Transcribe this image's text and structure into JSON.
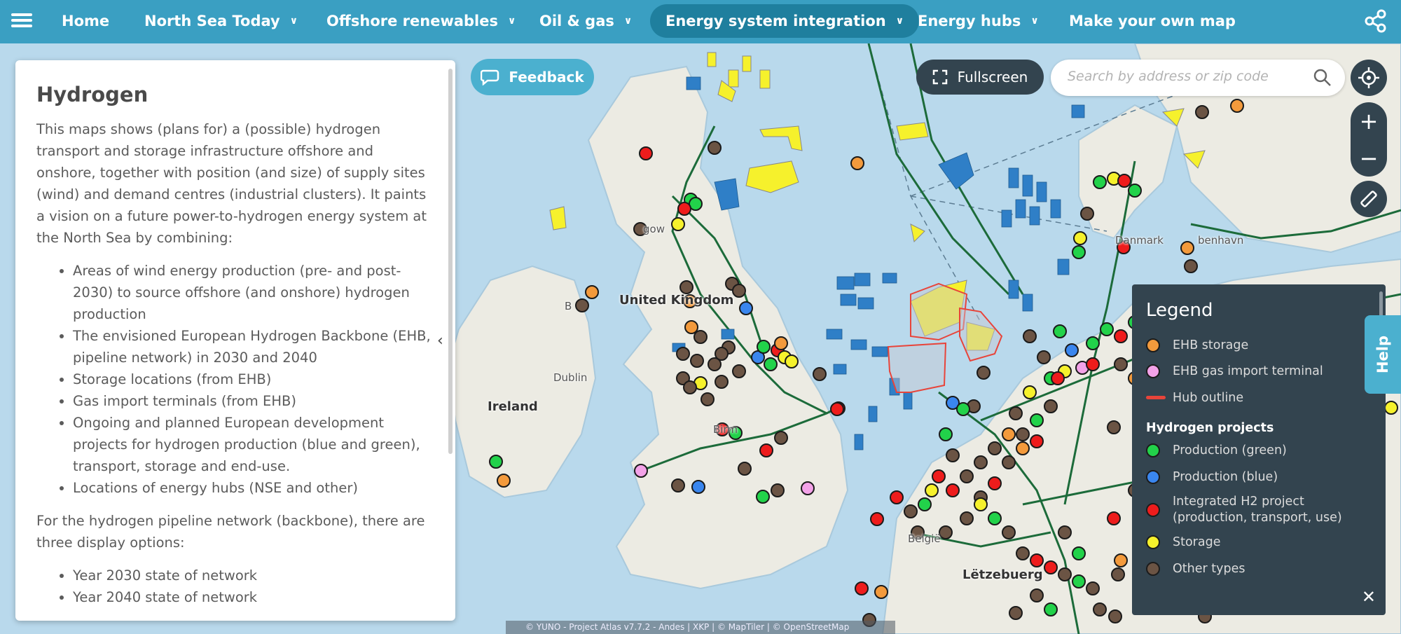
{
  "nav": {
    "home": "Home",
    "north_sea_today": "North Sea Today",
    "offshore_renewables": "Offshore renewables",
    "oil_gas": "Oil & gas",
    "energy_system_integration": "Energy system integration",
    "energy_hubs": "Energy hubs",
    "make_your_own_map": "Make your own map"
  },
  "panel": {
    "title": "Hydrogen",
    "intro": "This maps shows (plans for) a (possible) hydrogen transport and storage infrastructure offshore and onshore, together with position (and size) of supply sites (wind) and demand centres (industrial clusters). It paints a vision on a future power-to-hydrogen energy system at the North Sea by combining:",
    "bullets": [
      "Areas of wind energy production (pre- and post-2030) to source offshore (and onshore) hydrogen production",
      "The envisioned European Hydrogen Backbone (EHB, pipeline network) in 2030 and 2040",
      "Storage locations (from EHB)",
      "Gas import terminals (from EHB)",
      "Ongoing and planned European development projects for hydrogen production (blue and green), transport, storage and end-use.",
      "Locations of energy hubs (NSE and other)"
    ],
    "pipeline_text": "For the hydrogen pipeline network (backbone), there are three display options:",
    "options": [
      "Year 2030 state of network",
      "Year 2040 state of network"
    ]
  },
  "buttons": {
    "feedback": "Feedback",
    "fullscreen": "Fullscreen",
    "help": "Help"
  },
  "search": {
    "placeholder": "Search by address or zip code"
  },
  "legend": {
    "title": "Legend",
    "items": [
      {
        "label": "EHB storage",
        "color": "#f39a3c"
      },
      {
        "label": "EHB gas import terminal",
        "color": "#f3a2e8"
      },
      {
        "label": "Hub outline",
        "color": "#e8443a"
      }
    ],
    "section": "Hydrogen projects",
    "projects": [
      {
        "label": "Production (green)",
        "color": "#22d24a"
      },
      {
        "label": "Production (blue)",
        "color": "#3a86ee"
      },
      {
        "label": "Integrated H2 project (production, transport, use)",
        "color": "#ee1c1c"
      },
      {
        "label": "Storage",
        "color": "#f6f12c"
      },
      {
        "label": "Other types",
        "color": "#6b5444"
      }
    ]
  },
  "map_labels": {
    "ireland": "Ireland",
    "united_kingdom": "United Kingdom",
    "dublin": "Dublin",
    "denmark": "Danmark",
    "letzebuerg": "Lëtzebuerg",
    "belgie": "België",
    "birmingham": "Birm",
    "glasgow": "gow",
    "belfast": "B",
    "kobenhavn": "benhavn"
  },
  "attribution": "© YUNO - Project Atlas v7.7.2 - Andes | XKP | © MapTiler | © OpenStreetMap",
  "colors": {
    "nav_bg": "#3a9fc2",
    "nav_active": "#1f7f9e",
    "sea": "#b9d9ec",
    "land": "#ecebe3",
    "pipeline": "#1c6b3a",
    "legend_bg": "#33444f",
    "accent": "#4bb0cf"
  }
}
